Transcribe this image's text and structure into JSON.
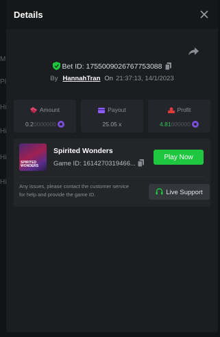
{
  "backdrop": {
    "fragments": [
      "M",
      "Pl",
      "Hi",
      "Hi",
      "Hi",
      "Hi"
    ]
  },
  "modal": {
    "title": "Details",
    "bet_id_text": "Bet ID: 1755009026767753088",
    "by_label": "By",
    "username": "HannahTran",
    "on_label": "On",
    "timestamp": "21:37:13, 14/1/2023"
  },
  "stats": {
    "amount": {
      "label": "Amount",
      "value_main": "0.2",
      "value_zeros": "0000000"
    },
    "payout": {
      "label": "Payout",
      "value": "25.05 x"
    },
    "profit": {
      "label": "Profit",
      "value_main": "4.81",
      "value_zeros": "000000"
    }
  },
  "game": {
    "thumb_text": "SPIRITED WONDERS",
    "name": "Spirited Wonders",
    "id_text": "Game ID: 1614270319466...",
    "play_label": "Play Now"
  },
  "support": {
    "text": "Any issues, please contact the customer service for help and provide the game ID.",
    "button_label": "Live Support"
  },
  "colors": {
    "accent_green": "#1fc63f",
    "profit_green": "#34c759",
    "coin_purple": "#7a4fd8",
    "amount_icon": "#e0456a",
    "payout_icon": "#8b5cf6",
    "profit_icon": "#e03a3a"
  },
  "icons": [
    "close-icon",
    "share-icon",
    "shield-check-icon",
    "copy-icon",
    "amount-icon",
    "payout-icon",
    "profit-icon",
    "coin-icon",
    "headset-icon"
  ]
}
